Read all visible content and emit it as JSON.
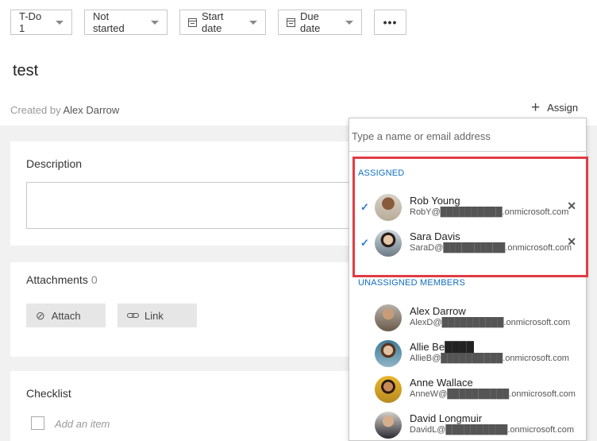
{
  "toolbar": {
    "bucket": "T-Do 1",
    "progress": "Not started",
    "start_date": "Start date",
    "due_date": "Due date",
    "more": "•••"
  },
  "task": {
    "title": "test",
    "created_by_label": "Created by",
    "created_by_name": "Alex Darrow"
  },
  "assign": {
    "button_label": "Assign",
    "search_placeholder": "Type a name or email address",
    "assigned_heading": "ASSIGNED",
    "unassigned_heading": "UNASSIGNED MEMBERS",
    "assigned": [
      {
        "name": "Rob Young",
        "email": "RobY@██████████.onmicrosoft.com"
      },
      {
        "name": "Sara Davis",
        "email": "SaraD@██████████.onmicrosoft.com"
      }
    ],
    "unassigned": [
      {
        "name": "Alex Darrow",
        "email": "AlexD@██████████.onmicrosoft.com"
      },
      {
        "name": "Allie Be████",
        "email": "AllieB@██████████.onmicrosoft.com"
      },
      {
        "name": "Anne Wallace",
        "email": "AnneW@██████████.onmicrosoft.com"
      },
      {
        "name": "David Longmuir",
        "email": "DavidL@██████████.onmicrosoft.com"
      }
    ]
  },
  "description": {
    "label": "Description"
  },
  "attachments": {
    "label": "Attachments",
    "count": "0",
    "attach_label": "Attach",
    "link_label": "Link"
  },
  "checklist": {
    "label": "Checklist",
    "add_placeholder": "Add an item"
  },
  "icons": {
    "check": "✓",
    "remove": "✕",
    "plus": "+",
    "paperclip": "📎"
  },
  "colors": {
    "accent": "#106ebe",
    "highlight": "#e03c44"
  }
}
